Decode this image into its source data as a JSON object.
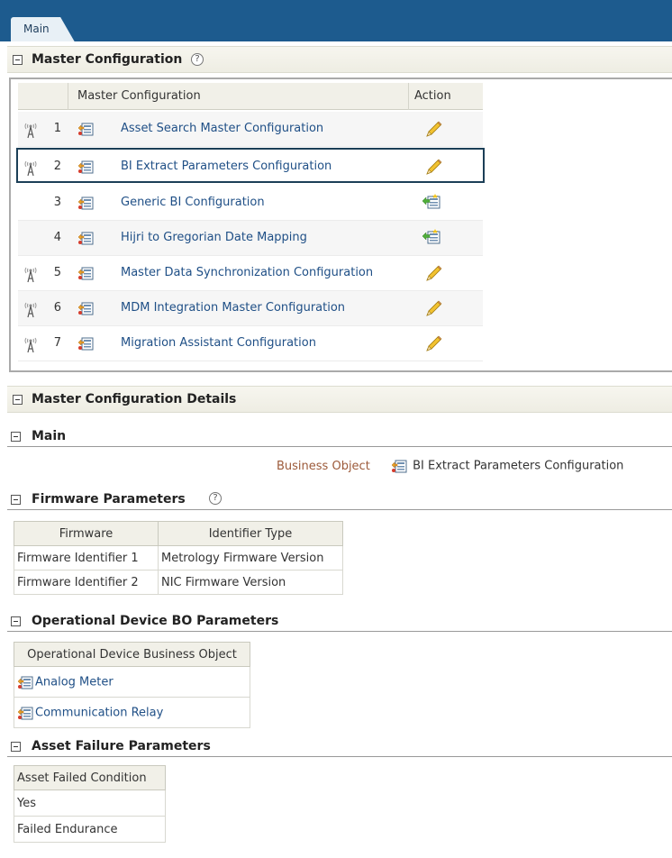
{
  "tabs": [
    {
      "label": "Main",
      "active": true
    }
  ],
  "master_section": {
    "title": "Master Configuration",
    "help": "?"
  },
  "grid": {
    "col_master": "Master Configuration",
    "col_action": "Action",
    "rows": [
      {
        "num": "1",
        "name": "Asset Search Master Configuration",
        "action": "edit",
        "antenna": true
      },
      {
        "num": "2",
        "name": "BI Extract Parameters Configuration",
        "action": "edit",
        "antenna": true,
        "selected": true
      },
      {
        "num": "3",
        "name": "Generic BI Configuration",
        "action": "add",
        "antenna": false
      },
      {
        "num": "4",
        "name": "Hijri to Gregorian Date Mapping",
        "action": "add",
        "antenna": false
      },
      {
        "num": "5",
        "name": "Master Data Synchronization Configuration",
        "action": "edit",
        "antenna": true
      },
      {
        "num": "6",
        "name": "MDM Integration Master Configuration",
        "action": "edit",
        "antenna": true
      },
      {
        "num": "7",
        "name": "Migration Assistant Configuration",
        "action": "edit",
        "antenna": true
      }
    ]
  },
  "details_section": {
    "title": "Master Configuration Details"
  },
  "main_sub": {
    "title": "Main",
    "bo_label": "Business Object",
    "bo_value": "BI Extract Parameters Configuration"
  },
  "firmware": {
    "title": "Firmware Parameters",
    "help": "?",
    "headers": [
      "Firmware",
      "Identifier Type"
    ],
    "rows": [
      [
        "Firmware Identifier 1",
        "Metrology Firmware Version"
      ],
      [
        "Firmware Identifier 2",
        "NIC Firmware Version"
      ]
    ]
  },
  "opdevice": {
    "title": "Operational Device BO Parameters",
    "header": "Operational Device Business Object",
    "rows": [
      "Analog Meter",
      "Communication Relay"
    ]
  },
  "asset_failure": {
    "title": "Asset Failure Parameters",
    "header": "Asset Failed Condition",
    "rows": [
      "Yes",
      "Failed Endurance"
    ]
  },
  "colors": {
    "topbar": "#1d5b8e",
    "link": "#1f4f86",
    "label": "#9c5a3a",
    "selected_border": "#1c3f57"
  }
}
